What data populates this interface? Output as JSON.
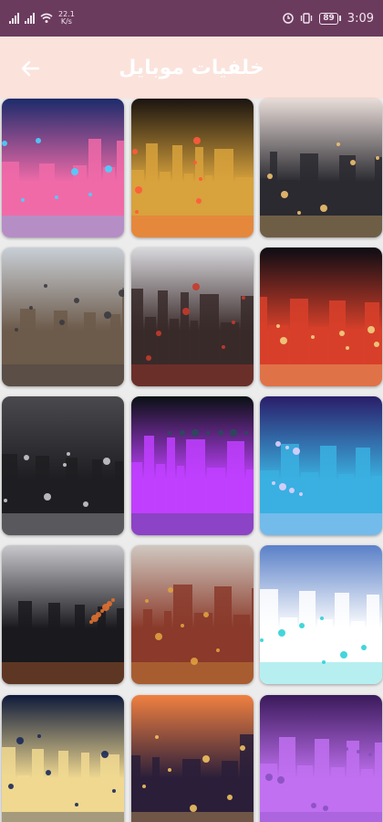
{
  "status_bar": {
    "speed_value": "22.1",
    "speed_unit": "K/s",
    "battery_level": "89",
    "time": "3:09"
  },
  "app_bar": {
    "title": "خلفيات موبايل",
    "back_icon": "arrow-back-icon"
  },
  "wallpapers": [
    {
      "name": "wallpaper-city-skyscrapers-neon",
      "colors": [
        "#1c2b6b",
        "#f06aa8",
        "#4ad0ff"
      ]
    },
    {
      "name": "wallpaper-motorcycle-night",
      "colors": [
        "#1a1410",
        "#d8a23c",
        "#ff5a3c"
      ]
    },
    {
      "name": "wallpaper-bridge-road-sunset",
      "colors": [
        "#e8dcd8",
        "#2a2a30",
        "#f0c070"
      ]
    },
    {
      "name": "wallpaper-paris-street-eiffel",
      "colors": [
        "#c9cfd6",
        "#6c5a4a",
        "#3a3a40"
      ]
    },
    {
      "name": "wallpaper-city-reflection",
      "colors": [
        "#d8d8dc",
        "#3a2a2a",
        "#c83a2a"
      ]
    },
    {
      "name": "wallpaper-city-night-lights",
      "colors": [
        "#0c0c14",
        "#d8402a",
        "#f0d080"
      ]
    },
    {
      "name": "wallpaper-rainy-street-cloudy",
      "colors": [
        "#4a4a4e",
        "#1e1e22",
        "#c8c8cc"
      ]
    },
    {
      "name": "wallpaper-neon-planet-space",
      "colors": [
        "#0a1014",
        "#c040ff",
        "#2a4a5a"
      ]
    },
    {
      "name": "wallpaper-marina-bay-sands",
      "colors": [
        "#2a1e6a",
        "#3ab0e0",
        "#e0d0ff"
      ]
    },
    {
      "name": "wallpaper-city-puddle-reflection",
      "colors": [
        "#c8c8cc",
        "#1a1a1e",
        "#e07030"
      ]
    },
    {
      "name": "wallpaper-railway-bridge-autumn",
      "colors": [
        "#d0c8c0",
        "#8a3a2a",
        "#e0a040"
      ]
    },
    {
      "name": "wallpaper-burj-khalifa-dubai",
      "colors": [
        "#5a80c8",
        "#ffffff",
        "#30d0d8"
      ]
    },
    {
      "name": "wallpaper-eiffel-tower-night",
      "colors": [
        "#0e1a3a",
        "#f0d890",
        "#1a2a5a"
      ]
    },
    {
      "name": "wallpaper-city-sunset-orange",
      "colors": [
        "#f08040",
        "#2a1e3a",
        "#f0c060"
      ]
    },
    {
      "name": "wallpaper-purple-city-aerial",
      "colors": [
        "#3a1a5a",
        "#c070f0",
        "#8a50c0"
      ]
    }
  ]
}
